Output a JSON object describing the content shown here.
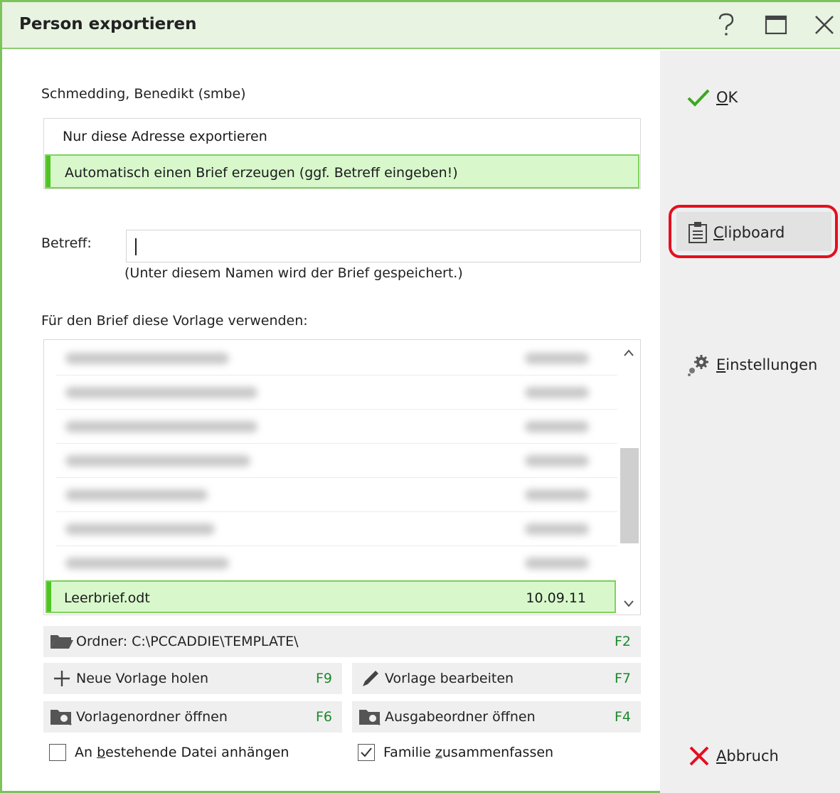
{
  "window": {
    "title": "Person exportieren",
    "help_icon": "help-icon",
    "maximize_icon": "maximize-icon",
    "close_icon": "close-icon"
  },
  "person": {
    "name": "Schmedding, Benedikt (smbe)"
  },
  "options": [
    {
      "label": "Nur diese Adresse exportieren",
      "selected": false
    },
    {
      "label": "Automatisch einen Brief erzeugen (ggf. Betreff eingeben!)",
      "selected": true
    }
  ],
  "subject": {
    "label": "Betreff:",
    "value": "",
    "hint": "(Unter diesem Namen wird der Brief gespeichert.)"
  },
  "template": {
    "heading": "Für den Brief diese Vorlage verwenden:",
    "selected_file": {
      "name": "Leerbrief.odt",
      "date": "10.09.11"
    }
  },
  "actions": {
    "folder": {
      "label": "Ordner: C:\\PCCADDIE\\TEMPLATE\\",
      "key": "F2"
    },
    "new_template": {
      "label": "Neue Vorlage holen",
      "key": "F9"
    },
    "edit_template": {
      "label": "Vorlage bearbeiten",
      "key": "F7"
    },
    "open_template_folder": {
      "label": "Vorlagenordner öffnen",
      "key": "F6"
    },
    "open_output_folder": {
      "label": "Ausgabeordner öffnen",
      "key": "F4"
    }
  },
  "checkboxes": {
    "append": {
      "label_pre": "An ",
      "label_ul": "b",
      "label_post": "estehende Datei anhängen",
      "checked": false
    },
    "family": {
      "label_pre": "Familie ",
      "label_ul": "z",
      "label_post": "usammenfassen",
      "checked": true
    }
  },
  "side": {
    "ok": {
      "ul": "O",
      "rest": "K"
    },
    "clipboard": {
      "ul": "C",
      "rest": "lipboard"
    },
    "settings": {
      "ul": "E",
      "rest": "instellungen"
    },
    "cancel": {
      "ul": "A",
      "rest": "bbruch"
    }
  },
  "colors": {
    "accent_green": "#7cc35b",
    "selection_bg": "#d8f8cc",
    "highlight_red": "#e3101f",
    "key_green": "#1a8a2a"
  }
}
